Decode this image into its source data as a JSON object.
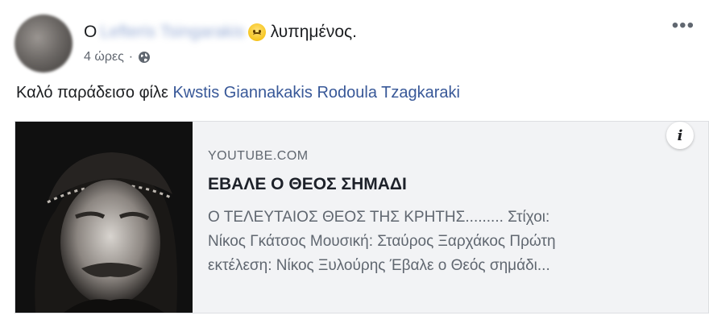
{
  "post": {
    "author_prefix": "O",
    "author_name_blurred": "Lefteris Tsingarakis",
    "feeling": "λυπημένος.",
    "timestamp": "4 ώρες",
    "separator": "·",
    "privacy_icon": "globe-icon",
    "more_icon": "•••",
    "text": "Καλό παράδεισο φίλε",
    "mentions": [
      "Kwstis Giannakakis",
      "Rodoula Tzagkaraki"
    ]
  },
  "link_card": {
    "domain": "YOUTUBE.COM",
    "title": "ΕΒΑΛΕ Ο ΘΕΟΣ ΣΗΜΑΔΙ",
    "description_lines": [
      "Ο ΤΕΛΕΥΤΑΙΟΣ ΘΕΟΣ ΤΗΣ ΚΡΗΤΗΣ......... Στίχοι:",
      "Νίκος Γκάτσος Μουσική: Σταύρος Ξαρχάκος Πρώτη",
      "εκτέλεση: Νίκος Ξυλούρης Έβαλε ο Θεός σημάδι..."
    ],
    "info_icon": "i"
  },
  "colors": {
    "link_blue": "#385898",
    "card_bg": "#f2f3f5",
    "meta_gray": "#616770"
  }
}
